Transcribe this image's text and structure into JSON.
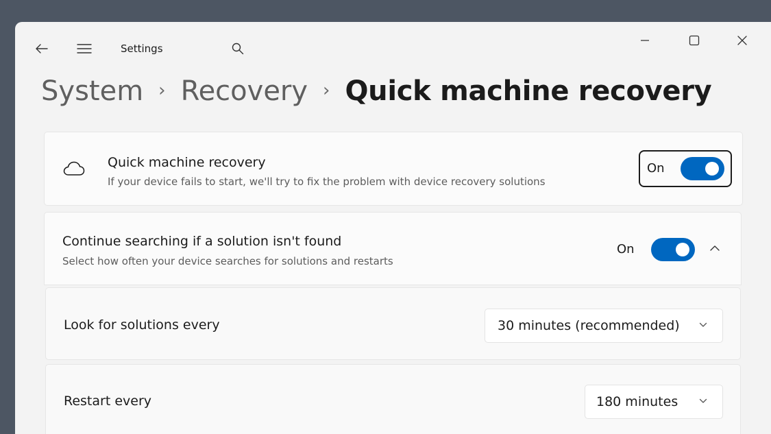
{
  "window": {
    "app_title": "Settings",
    "icons": {
      "back": "back-arrow-icon",
      "menu": "hamburger-menu-icon",
      "search": "search-icon",
      "minimize": "minimize-icon",
      "maximize": "maximize-icon",
      "close": "close-icon"
    }
  },
  "breadcrumb": {
    "items": [
      "System",
      "Recovery"
    ],
    "current": "Quick machine recovery",
    "separator": "›"
  },
  "quick_machine_recovery": {
    "icon": "cloud-icon",
    "title": "Quick machine recovery",
    "description": "If your device fails to start, we'll try to fix the problem with device recovery solutions",
    "toggle_state": "On",
    "toggle_on": true
  },
  "continue_searching": {
    "title": "Continue searching if a solution isn't found",
    "description": "Select how often your device searches for solutions and restarts",
    "toggle_state": "On",
    "toggle_on": true,
    "expanded": true
  },
  "look_for_solutions": {
    "label": "Look for solutions every",
    "selected": "30 minutes (recommended)"
  },
  "restart_every": {
    "label": "Restart every",
    "selected": "180 minutes"
  },
  "colors": {
    "accent": "#0067c0",
    "desktop": "#4d5663",
    "window_bg": "#f3f3f3",
    "card_bg": "#fbfbfb"
  }
}
